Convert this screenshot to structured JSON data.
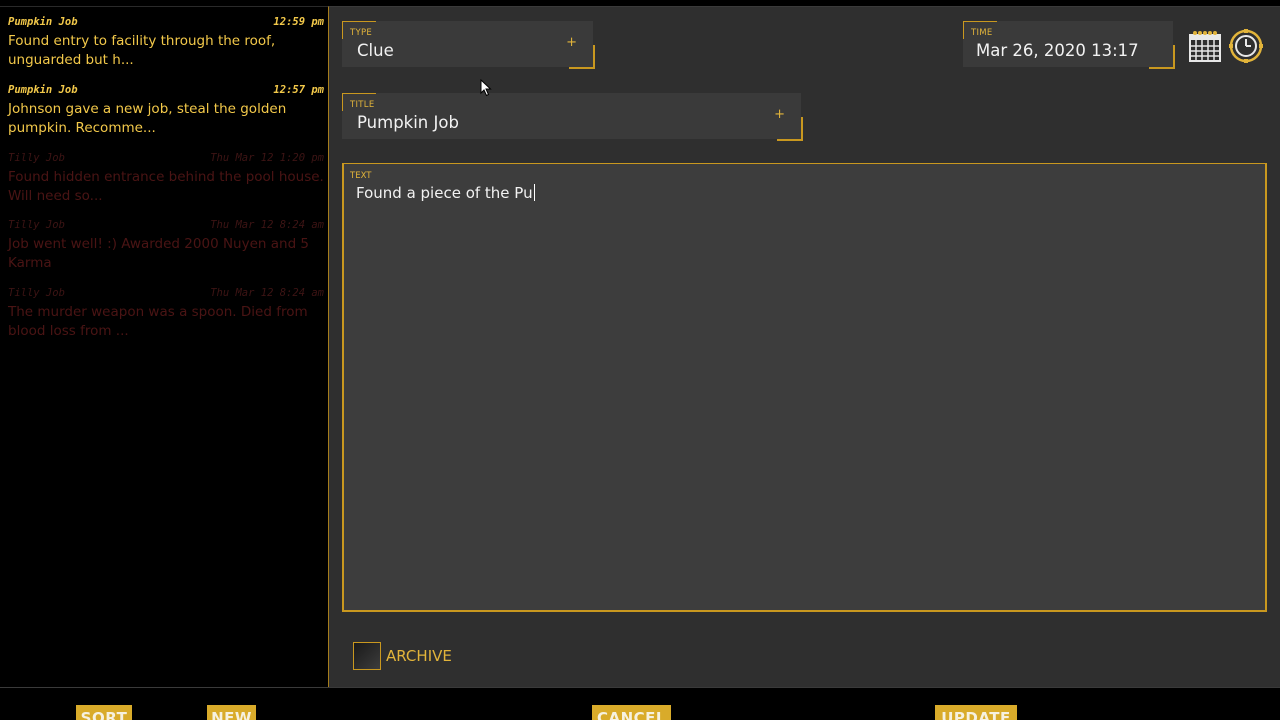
{
  "entries": [
    {
      "title": "Pumpkin Job",
      "time": "12:59 pm",
      "text": "Found entry to facility through the roof, unguarded but h...",
      "state": "active"
    },
    {
      "title": "Pumpkin Job",
      "time": "12:57 pm",
      "text": "Johnson gave a new job, steal the golden pumpkin. Recomme...",
      "state": "active"
    },
    {
      "title": "Tilly Job",
      "time": "Thu Mar 12 1:20 pm",
      "text": "Found hidden entrance behind the pool house. Will need so...",
      "state": "dim"
    },
    {
      "title": "Tilly Job",
      "time": "Thu Mar 12 8:24 am",
      "text": "Job went well! :) Awarded 2000 Nuyen and 5 Karma",
      "state": "dim"
    },
    {
      "title": "Tilly Job",
      "time": "Thu Mar 12 8:24 am",
      "text": "The murder weapon was a spoon. Died from blood loss from ...",
      "state": "dim"
    }
  ],
  "form": {
    "type_label": "TYPE",
    "type_value": "Clue",
    "title_label": "TITLE",
    "title_value": "Pumpkin Job",
    "time_label": "TIME",
    "time_value": "Mar 26, 2020 13:17",
    "text_label": "TEXT",
    "text_value": "Found a piece of the Pu",
    "plus": "+",
    "archive_label": "ARCHIVE",
    "archive_checked": false
  },
  "buttons": {
    "sort": "SORT",
    "new": "NEW",
    "cancel": "CANCEL",
    "update": "UPDATE"
  },
  "icons": {
    "calendar": "calendar-icon",
    "clock": "clock-icon"
  },
  "colors": {
    "accent": "#c9981f",
    "text_active": "#f3c94a",
    "text_dim": "#4a1414",
    "panel_bg": "#2f2f2f"
  }
}
